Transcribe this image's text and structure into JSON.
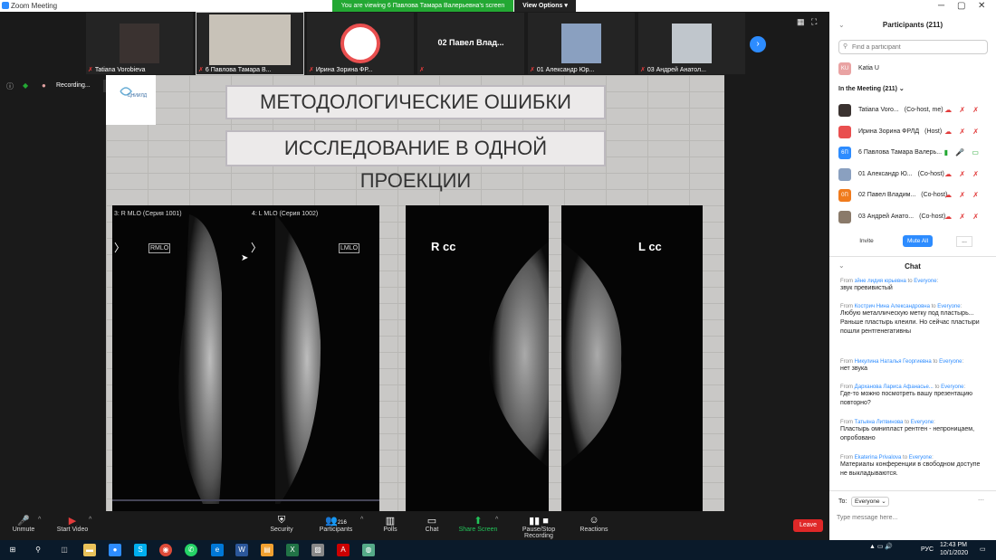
{
  "window": {
    "title": "Zoom Meeting"
  },
  "banner": {
    "viewing": "You are viewing 6 Павлова Тамара Валерьевна's screen",
    "view_options": "View Options"
  },
  "video_strip": [
    {
      "name": "Tatiana Vorobieva",
      "type": "photo",
      "color": "#3a3230"
    },
    {
      "name": "6 Павлова Тамара В...",
      "type": "photo",
      "color": "#c8c2b8"
    },
    {
      "name": "Ирина Зорина ФР...",
      "type": "logo",
      "color": "#ffffff"
    },
    {
      "name": "02 Павел Влад...",
      "type": "text",
      "color": "#242424"
    },
    {
      "name": "01 Александр Юр...",
      "type": "photo",
      "color": "#8aa0c0"
    },
    {
      "name": "03 Андрей Анатол...",
      "type": "photo",
      "color": "#c0c6cc"
    }
  ],
  "recording": {
    "label": "Recording..."
  },
  "slide": {
    "title1": "МЕТОДОЛОГИЧЕСКИЕ ОШИБКИ",
    "title2": "ИССЛЕДОВАНИЕ В ОДНОЙ ПРОЕКЦИИ",
    "logo_text": "ЦНИИЛД",
    "panel1_label": "3: R MLO (Серия 1001)",
    "panel2_label": "4: L MLO (Серия 1002)",
    "marker1": "RMLO",
    "marker2": "LMLO",
    "rcc": "R cc",
    "lcc": "L cc"
  },
  "participants": {
    "title": "Participants (211)",
    "search_placeholder": "Find a participant",
    "waiting": {
      "initials": "KU",
      "name": "Katia U",
      "color": "#e9a3a3"
    },
    "in_meeting_label": "In the Meeting (211)",
    "list": [
      {
        "initials": "",
        "name": "Tatiana Voro...",
        "role": "(Co-host, me)",
        "color": "#3a3230"
      },
      {
        "initials": "",
        "name": "Ирина Зорина ФРЛД",
        "role": "(Host)",
        "color": "#e94f4f"
      },
      {
        "initials": "6П",
        "name": "6 Павлова Тамара Валерь...",
        "role": "",
        "color": "#2d8cff"
      },
      {
        "initials": "",
        "name": "01 Александр Ю...",
        "role": "(Co-host)",
        "color": "#8aa0c0"
      },
      {
        "initials": "0П",
        "name": "02 Павел Владим...",
        "role": "(Co-host)",
        "color": "#f07b1d"
      },
      {
        "initials": "",
        "name": "03 Андрей Анато...",
        "role": "(Co-host)",
        "color": "#8a7a6a"
      }
    ],
    "invite": "Invite",
    "mute_all": "Mute All",
    "more": "..."
  },
  "chat": {
    "title": "Chat",
    "messages": [
      {
        "from": "зйне лидия юрьевна",
        "to": "Everyone",
        "text": "звук превивистый"
      },
      {
        "from": "Кострич Нина Александровна",
        "to": "Everyone",
        "text": "Любую металлическую метку под пластырь... Раньше пластырь клеили. Но сейчас пластыри пошли рентгенегативны"
      },
      {
        "from": "Никулина Наталья Георгиевна",
        "to": "Everyone",
        "text": "нет звука"
      },
      {
        "from": "Дарханова Лариса Афанасье...",
        "to": "Everyone",
        "text": "Где-то можно посмотреть вашу презентацию повторно?"
      },
      {
        "from": "Татьяна Литвинова",
        "to": "Everyone",
        "text": "Пластырь омнипласт рентген - непроницаем, опробовано"
      },
      {
        "from": "Ekaterina Privalova",
        "to": "Everyone",
        "text": "Материалы конференции в свободном доступе не выкладываются."
      }
    ],
    "from_label": "From",
    "to_label": "to",
    "send_to_label": "To:",
    "send_to_value": "Everyone",
    "input_placeholder": "Type message here..."
  },
  "toolbar": {
    "unmute": "Unmute",
    "start_video": "Start Video",
    "security": "Security",
    "participants": "Participants",
    "participants_count": "216",
    "polls": "Polls",
    "chat": "Chat",
    "share_screen": "Share Screen",
    "pause_recording": "Pause/Stop Recording",
    "reactions": "Reactions",
    "leave": "Leave"
  },
  "taskbar": {
    "time": "12:43 PM",
    "date": "10/1/2020",
    "lang": "РУС"
  }
}
